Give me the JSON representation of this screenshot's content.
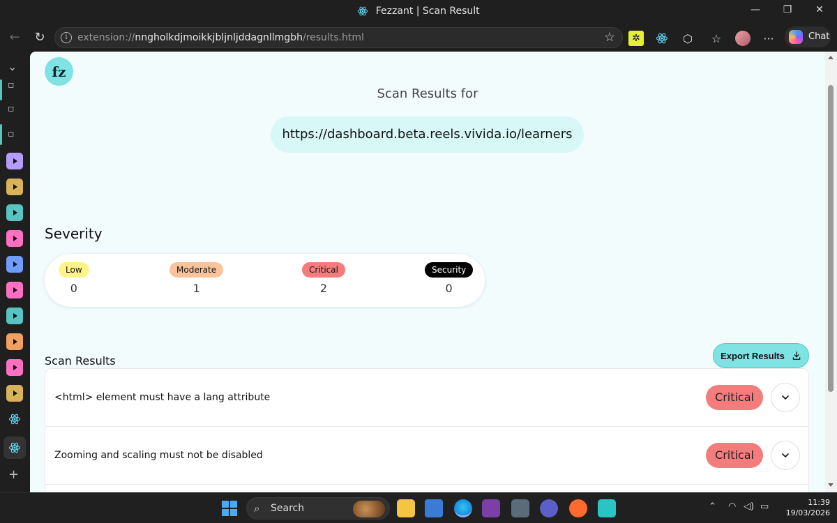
{
  "window": {
    "title": "Fezzant | Scan Result",
    "minimize": "—",
    "restore": "❐",
    "close": "✕"
  },
  "browser": {
    "url_prefix": "extension://",
    "url_host": "nngholkdjmoikkjbljnljddagnllmgbh",
    "url_path": "/results.html",
    "chat_label": "Chat"
  },
  "page": {
    "logo_text": "fz",
    "scan_results_for_label": "Scan Results for",
    "scanned_url": "https://dashboard.beta.reels.vivida.io/learners",
    "severity_heading": "Severity",
    "severity": [
      {
        "label": "Low",
        "count": "0",
        "color": "#fff38a",
        "text_color": "#111"
      },
      {
        "label": "Moderate",
        "count": "1",
        "color": "#f9c39c",
        "text_color": "#111"
      },
      {
        "label": "Critical",
        "count": "2",
        "color": "#f47c7c",
        "text_color": "#111"
      },
      {
        "label": "Security",
        "count": "0",
        "color": "#000000",
        "text_color": "#ffffff"
      }
    ],
    "results_heading": "Scan Results",
    "export_label": "Export Results",
    "results": [
      {
        "text": "<html> element must have a lang attribute",
        "severity": "Critical"
      },
      {
        "text": "Zooming and scaling must not be disabled",
        "severity": "Critical"
      }
    ]
  },
  "taskbar": {
    "search_label": "Search",
    "time": "11:39",
    "date": "19/03/2026"
  },
  "colors": {
    "accent": "#7fe3e3",
    "critical": "#f47c7c",
    "page_bg": "#f2fcfd"
  }
}
